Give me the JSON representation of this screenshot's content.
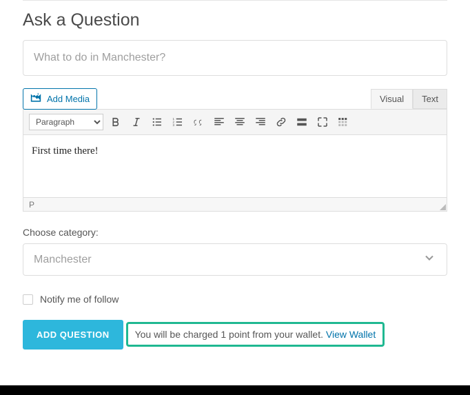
{
  "page": {
    "title": "Ask a Question"
  },
  "title_input": {
    "value": "",
    "placeholder": "What to do in Manchester?"
  },
  "media_button": {
    "label": "Add Media"
  },
  "tabs": {
    "visual": "Visual",
    "text": "Text"
  },
  "toolbar": {
    "format_option": "Paragraph"
  },
  "editor": {
    "content": "First time there!",
    "status_path": "P"
  },
  "category": {
    "label": "Choose category:",
    "selected": "Manchester"
  },
  "notify": {
    "label": "Notify me of follow"
  },
  "submit": {
    "label": "ADD QUESTION"
  },
  "notice": {
    "text": "You will be charged 1 point from your wallet. ",
    "link_text": "View Wallet"
  }
}
